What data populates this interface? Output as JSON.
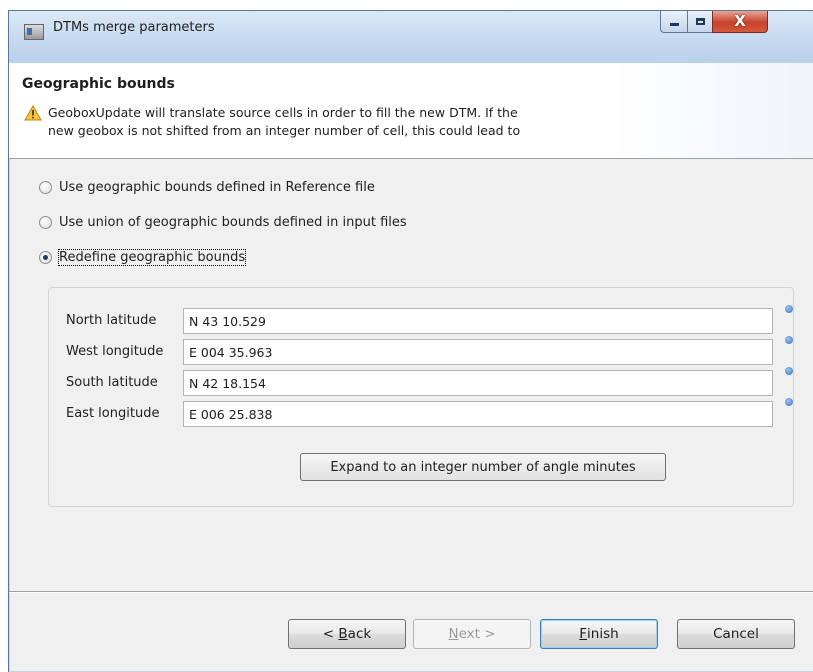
{
  "window": {
    "title": "DTMs merge parameters",
    "close_glyph": "X"
  },
  "header": {
    "title": "Geographic bounds",
    "message_line1": "GeoboxUpdate will translate source cells in order to fill the new DTM. If the",
    "message_line2": "new geobox is not shifted from an integer number of cell, this could lead to",
    "icon": "warning-icon"
  },
  "options": [
    {
      "label": "Use geographic bounds defined in Reference file",
      "selected": false
    },
    {
      "label": "Use union of geographic bounds defined in input files",
      "selected": false
    },
    {
      "label": "Redefine geographic bounds",
      "selected": true
    }
  ],
  "bounds": {
    "north": {
      "label": "North latitude",
      "value": "N 43 10.529"
    },
    "west": {
      "label": "West longitude",
      "value": "E 004 35.963"
    },
    "south": {
      "label": "South latitude",
      "value": "N 42 18.154"
    },
    "east": {
      "label": "East longitude",
      "value": "E 006 25.838"
    },
    "expand_label": "Expand to an integer number of angle minutes"
  },
  "buttons": {
    "back": {
      "mnemonic": "B",
      "rest": "ack",
      "prefix": "< "
    },
    "next": {
      "mnemonic": "N",
      "rest": "ext >"
    },
    "finish": {
      "mnemonic": "F",
      "rest": "inish"
    },
    "cancel": "Cancel"
  },
  "colors": {
    "titlebar": "#c9dcf1",
    "close": "#c7432c",
    "default_button_border": "#3c7fb1"
  }
}
